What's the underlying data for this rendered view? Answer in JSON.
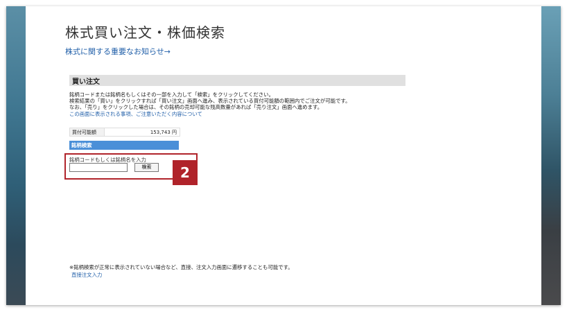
{
  "page": {
    "title": "株式買い注文・株価検索",
    "notice_link": "株式に関する重要なお知らせ→"
  },
  "order_section": {
    "header": "買い注文",
    "instructions": [
      "銘柄コードまたは銘柄名もしくはその一部を入力して「検索」をクリックしてください。",
      "検索結果の「買い」をクリックすれば「買い注文」画面へ進み、表示されている買付可能額の範囲内でご注文が可能です。",
      "なお、「売り」をクリックした場合は、その銘柄の売却可能な残高数量があれば「売り注文」画面へ進めます。"
    ],
    "notice_link": "この画面に表示される事項、ご注意いただく内容について"
  },
  "buying_power": {
    "label": "買付可能額",
    "value": "153,743 円"
  },
  "stock_search": {
    "header": "銘柄検索",
    "caption": "銘柄コードもしくは銘柄名を入力",
    "input_value": "",
    "button_label": "検索"
  },
  "annotation": {
    "step_number": "2",
    "color": "#b0232a"
  },
  "footer": {
    "note": "※銘柄検索が正常に表示されていない場合など、直接、注文入力画面に遷移することも可能です。",
    "direct_link": "直接注文入力"
  },
  "colors": {
    "link": "#1f5ea8",
    "search_header": "#4a8fd8",
    "section_header": "#e0e0e0"
  }
}
